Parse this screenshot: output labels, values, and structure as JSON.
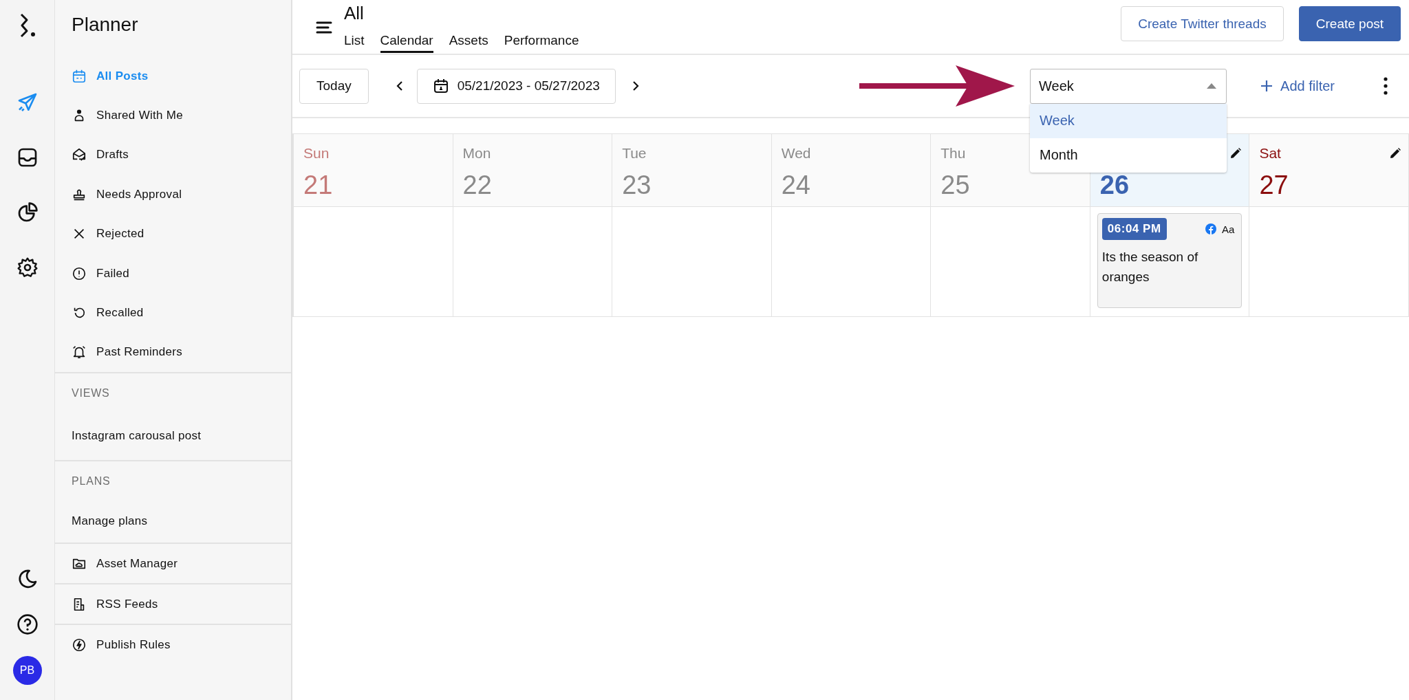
{
  "rail": {
    "items": [
      {
        "selected": true
      },
      {
        "selected": false
      },
      {
        "selected": false
      },
      {
        "selected": false
      }
    ],
    "avatar": "PB"
  },
  "sidebar": {
    "title": "Planner",
    "items": [
      {
        "label": "All Posts",
        "selected": true
      },
      {
        "label": "Shared With Me",
        "selected": false
      },
      {
        "label": "Drafts",
        "selected": false
      },
      {
        "label": "Needs Approval",
        "selected": false
      },
      {
        "label": "Rejected",
        "selected": false
      },
      {
        "label": "Failed",
        "selected": false
      },
      {
        "label": "Recalled",
        "selected": false
      },
      {
        "label": "Past Reminders",
        "selected": false
      }
    ],
    "sections": [
      {
        "heading": "VIEWS",
        "items": [
          "Instagram carousal post"
        ]
      },
      {
        "heading": "PLANS",
        "items": [
          "Manage plans"
        ]
      }
    ],
    "links": [
      "Asset Manager",
      "RSS Feeds",
      "Publish Rules"
    ]
  },
  "header": {
    "title": "All",
    "tabs": [
      {
        "label": "List",
        "selected": false
      },
      {
        "label": "Calendar",
        "selected": true
      },
      {
        "label": "Assets",
        "selected": false
      },
      {
        "label": "Performance",
        "selected": false
      }
    ],
    "buttons": [
      {
        "label": "Create Twitter threads",
        "kind": "outline"
      },
      {
        "label": "Create post",
        "kind": "primary"
      }
    ]
  },
  "toolbar": {
    "today": "Today",
    "date_range": "05/21/2023 - 05/27/2023",
    "view_select": {
      "value": "Week",
      "options": [
        {
          "label": "Week",
          "selected": true
        },
        {
          "label": "Month",
          "selected": false
        }
      ]
    },
    "add_filter": "Add filter"
  },
  "calendar": {
    "days": [
      {
        "name": "Sun",
        "date": "21",
        "color": "#c47a78",
        "selected": false,
        "editable": false
      },
      {
        "name": "Mon",
        "date": "22",
        "color": "#8a8a8a",
        "selected": false,
        "editable": false
      },
      {
        "name": "Tue",
        "date": "23",
        "color": "#8a8a8a",
        "selected": false,
        "editable": false
      },
      {
        "name": "Wed",
        "date": "24",
        "color": "#8a8a8a",
        "selected": false,
        "editable": false
      },
      {
        "name": "Thu",
        "date": "25",
        "color": "#8a8a8a",
        "selected": false,
        "editable": false
      },
      {
        "date": "26",
        "color": "#3a63b0",
        "selected": true,
        "editable": true,
        "events": [
          {
            "time": "06:04 PM",
            "format": "Aa",
            "text": "Its the season of oranges"
          }
        ]
      },
      {
        "name": "Sat",
        "date": "27",
        "color": "#8b0e0e",
        "selected": false,
        "editable": true
      }
    ]
  }
}
